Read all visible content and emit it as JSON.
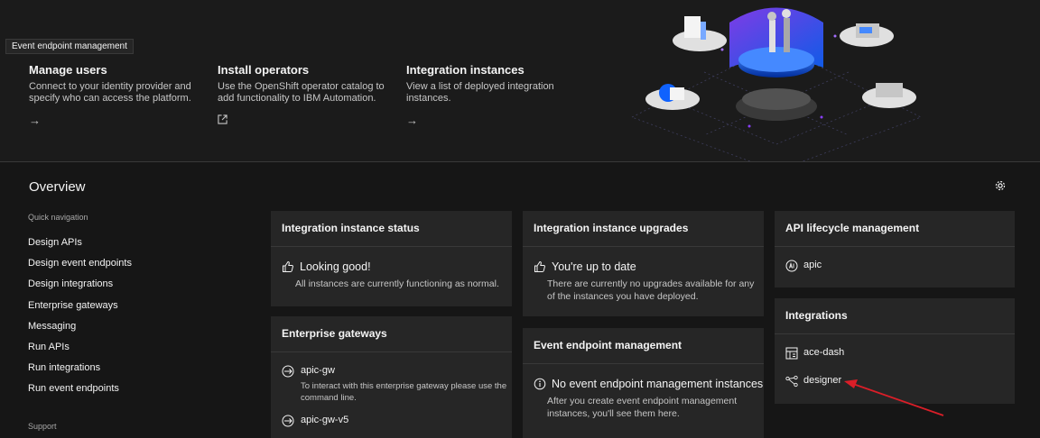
{
  "tooltip": "Event endpoint management",
  "hero_cards": [
    {
      "title": "Manage users",
      "desc": "Connect to your identity provider and specify who can access the platform.",
      "link_icon": "arrow-right-icon"
    },
    {
      "title": "Install operators",
      "desc": "Use the OpenShift operator catalog to add functionality to IBM Automation.",
      "link_icon": "launch-icon"
    },
    {
      "title": "Integration instances",
      "desc": "View a list of deployed integration instances.",
      "link_icon": "arrow-right-icon"
    }
  ],
  "overview": {
    "title": "Overview",
    "quick_nav_label": "Quick navigation",
    "quick_nav": [
      "Design APIs",
      "Design event endpoints",
      "Design integrations",
      "Enterprise gateways",
      "Messaging",
      "Run APIs",
      "Run integrations",
      "Run event endpoints"
    ],
    "support_label": "Support"
  },
  "tiles": {
    "status": {
      "title": "Integration instance status",
      "headline": "Looking good!",
      "desc": "All instances are currently functioning as normal.",
      "icon": "thumbs-up-icon"
    },
    "upgrades": {
      "title": "Integration instance upgrades",
      "headline": "You're up to date",
      "desc": "There are currently no upgrades available for any of the instances you have deployed.",
      "icon": "thumbs-up-icon"
    },
    "api": {
      "title": "API lifecycle management",
      "items": [
        "apic"
      ]
    },
    "integrations": {
      "title": "Integrations",
      "items": [
        "ace-dash",
        "designer"
      ]
    },
    "gateways": {
      "title": "Enterprise gateways",
      "items": [
        {
          "name": "apic-gw",
          "desc": "To interact with this enterprise gateway please use the command line."
        },
        {
          "name": "apic-gw-v5",
          "desc": ""
        }
      ]
    },
    "events": {
      "title": "Event endpoint management",
      "headline": "No event endpoint management instances",
      "desc": "After you create event endpoint management instances, you'll see them here.",
      "icon": "info-icon"
    }
  },
  "colors": {
    "background": "#161616",
    "tile": "#262626",
    "annotation_arrow": "#da1e28"
  }
}
